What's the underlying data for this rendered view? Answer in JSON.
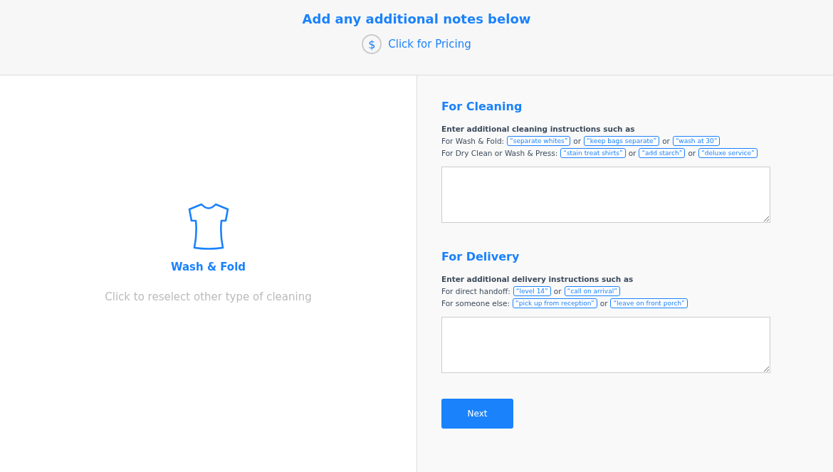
{
  "header": {
    "title": "Add any additional notes below",
    "pricing_link": "Click for Pricing",
    "pricing_icon": "$"
  },
  "selection": {
    "service": "Wash & Fold",
    "hint": "Click to reselect other type of cleaning"
  },
  "sections": [
    {
      "title": "For Cleaning",
      "intro": "Enter additional cleaning instructions such as",
      "lines": [
        {
          "label": "For Wash & Fold:",
          "items": [
            {
              "kind": "chip",
              "text": "“separate whites”"
            },
            {
              "kind": "word",
              "text": "or"
            },
            {
              "kind": "chip",
              "text": "“keep bags separate”"
            },
            {
              "kind": "word",
              "text": "or"
            },
            {
              "kind": "chip",
              "text": "“wash at 30”"
            }
          ]
        },
        {
          "label": "For Dry Clean or Wash & Press:",
          "items": [
            {
              "kind": "chip",
              "text": "“stain treat shirts”"
            },
            {
              "kind": "word",
              "text": "or"
            },
            {
              "kind": "chip",
              "text": "“add starch”"
            },
            {
              "kind": "word",
              "text": "or"
            },
            {
              "kind": "chip",
              "text": "“deluxe service”"
            }
          ]
        }
      ]
    },
    {
      "title": "For Delivery",
      "intro": "Enter additional delivery instructions such as",
      "lines": [
        {
          "label": "For direct handoff:",
          "items": [
            {
              "kind": "chip",
              "text": "“level 14”"
            },
            {
              "kind": "word",
              "text": "or"
            },
            {
              "kind": "chip",
              "text": "“call on arrival”"
            }
          ]
        },
        {
          "label": "For someone else:",
          "items": [
            {
              "kind": "chip",
              "text": "“pick up from reception”"
            },
            {
              "kind": "word",
              "text": "or"
            },
            {
              "kind": "chip",
              "text": "“leave on front porch”"
            }
          ]
        }
      ]
    }
  ],
  "next_button": "Next"
}
